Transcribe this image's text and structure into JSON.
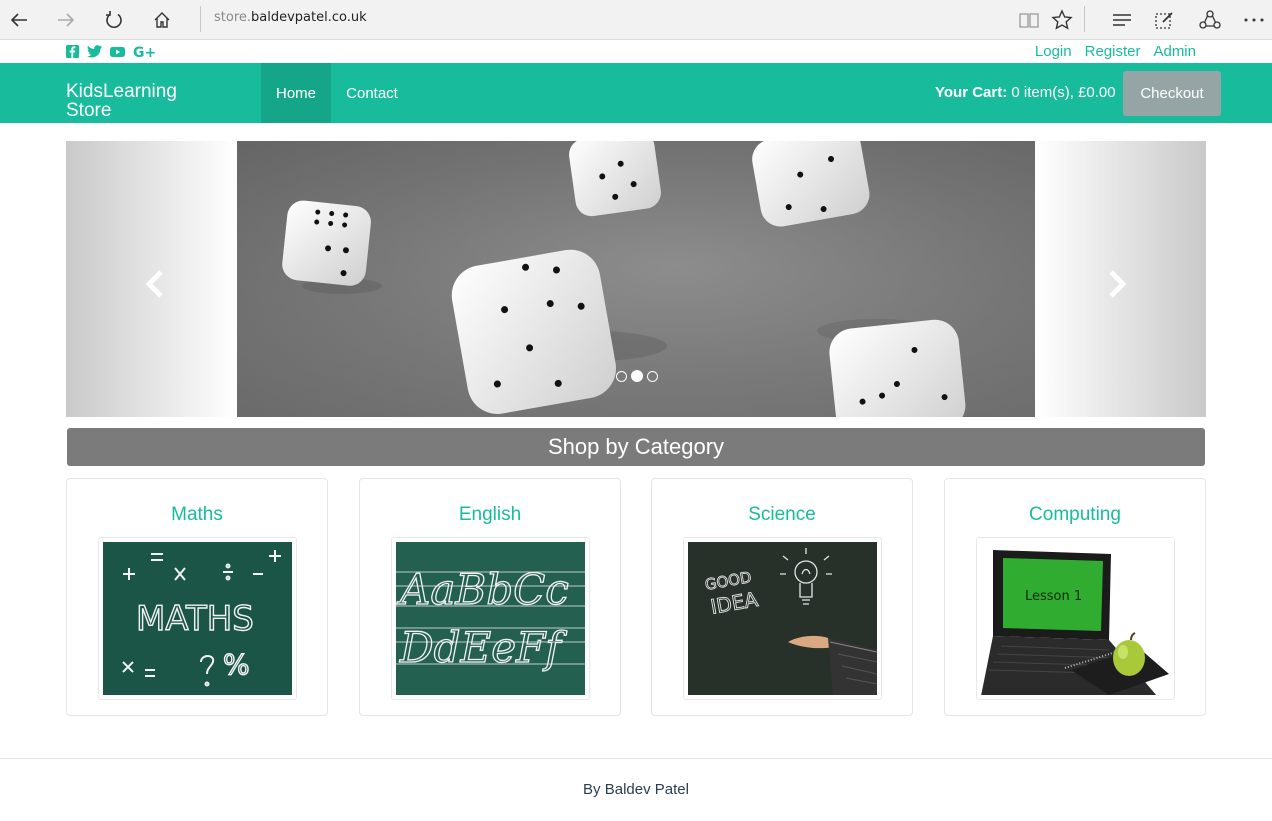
{
  "browser": {
    "url_prefix": "store.",
    "url_domain": "baldevpatel.co.uk"
  },
  "account": {
    "login": "Login",
    "register": "Register",
    "admin": "Admin"
  },
  "navbar": {
    "brand_line1": "KidsLearning",
    "brand_line2": "Store",
    "home": "Home",
    "contact": "Contact",
    "cart_label": "Your Cart:",
    "cart_value": "0 item(s), £0.00",
    "checkout": "Checkout"
  },
  "carousel": {
    "slides": 3,
    "active_index": 1
  },
  "categories": {
    "heading": "Shop by Category",
    "items": [
      {
        "name": "Maths"
      },
      {
        "name": "English"
      },
      {
        "name": "Science"
      },
      {
        "name": "Computing"
      }
    ]
  },
  "images": {
    "maths_text": "MATHS",
    "english_row1": "AaBbCc",
    "english_row2": "DdEeFf",
    "science_text1": "GOOD",
    "science_text2": "IDEA",
    "computing_text": "Lesson 1"
  },
  "footer": {
    "text": "By Baldev Patel"
  },
  "colors": {
    "brand": "#18bc9c",
    "brand_dark": "#15a589",
    "checkout": "#95a5a6",
    "category_header": "#7b7b7b"
  }
}
